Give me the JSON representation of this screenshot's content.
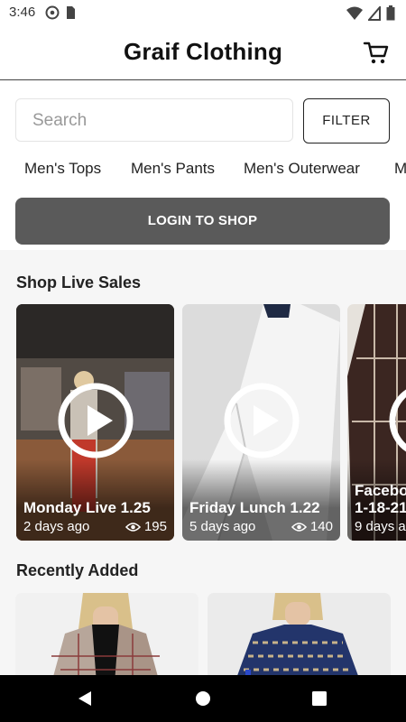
{
  "status_bar": {
    "time": "3:46"
  },
  "header": {
    "title": "Graif Clothing"
  },
  "search": {
    "placeholder": "Search"
  },
  "filter": {
    "label": "FILTER"
  },
  "categories": [
    "Men's Tops",
    "Men's Pants",
    "Men's Outerwear",
    "M"
  ],
  "login": {
    "label": "LOGIN TO SHOP"
  },
  "live_sales": {
    "title": "Shop Live Sales",
    "items": [
      {
        "title": "Monday Live 1.25",
        "time": "2 days ago",
        "views": "195"
      },
      {
        "title": "Friday Lunch 1.22",
        "time": "5 days ago",
        "views": "140"
      },
      {
        "title": "Facebo",
        "subtitle": "1-18-21",
        "time": "9 days a",
        "views": ""
      }
    ]
  },
  "recently_added": {
    "title": "Recently Added"
  },
  "colors": {
    "accent": "#5a5a5a",
    "nav_bar": "#000000"
  }
}
